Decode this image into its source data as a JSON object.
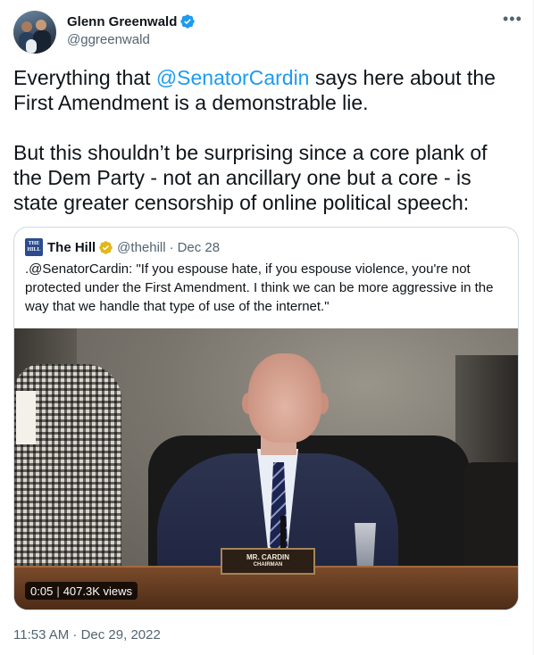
{
  "author": {
    "display_name": "Glenn Greenwald",
    "handle": "@ggreenwald",
    "verified": true,
    "verified_color": "#1d9bf0"
  },
  "tweet": {
    "para1": {
      "pre": "Everything that ",
      "mention": "@SenatorCardin",
      "post": " says here about the First Amendment is a demonstrable lie."
    },
    "para2": "But this shouldn’t be surprising since a core plank of the Dem Party - not an ancillary one but a core - is state greater censorship of online political speech:"
  },
  "quoted": {
    "logo_text": "THE HILL",
    "name": "The Hill",
    "verified_badge_color": "#e2b719",
    "handle": "@thehill",
    "dot": "·",
    "date": "Dec 28",
    "text": ".@SenatorCardin: \"If you espouse hate, if you espouse violence, you're not protected under the First Amendment. I think we can be more aggressive in the way that we handle that type of use of the internet.\"",
    "video": {
      "time": "0:05",
      "separator": "|",
      "views": "407.3K views",
      "nameplate_line1": "MR. CARDIN",
      "nameplate_line2": "CHAIRMAN"
    }
  },
  "timestamp": "11:53 AM · Dec 29, 2022",
  "colors": {
    "link": "#1d9bf0",
    "secondary_text": "#536471",
    "border": "#cfd9de"
  },
  "icons": {
    "more": "more-horizontal-icon",
    "verified": "verified-badge-icon"
  }
}
